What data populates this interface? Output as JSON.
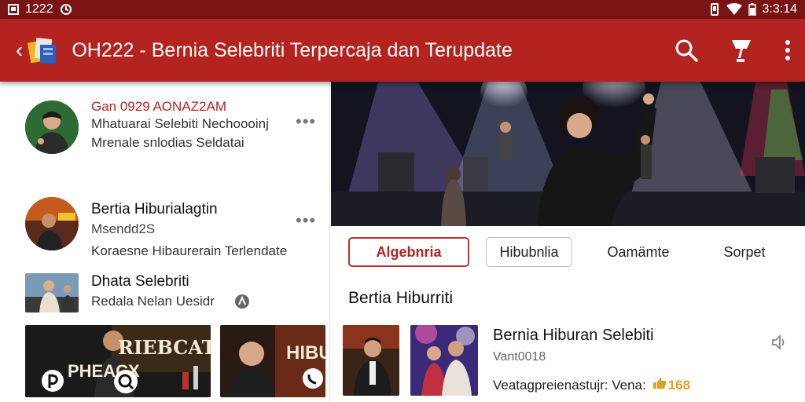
{
  "status_bar": {
    "time": "1222",
    "clock": "3:3:14",
    "left_icons": [
      "notification-icon",
      "sync-icon"
    ],
    "right_icons": [
      "vibrate-icon",
      "wifi-icon",
      "battery-icon"
    ]
  },
  "app_bar": {
    "title": "OH222 - Bernia Selebriti Terpercaja dan Terupdate",
    "actions": [
      "search-icon",
      "trophy-icon",
      "more-vert-icon"
    ],
    "background": "#b3231f"
  },
  "left_list": {
    "items": [
      {
        "title": "Gan 0929 AONAZ2AM",
        "subtitle": "Mhatuarai Selebiti Nechoooinj",
        "line3": "Mrenale snlodias Seldatai",
        "more": "•••"
      },
      {
        "title": "Bertia Hiburialagtin",
        "subtitle": "Msendd2S",
        "line3": "Koraesne Hibaurerain Terlendate",
        "more": "•••"
      },
      {
        "title": "Dhata Selebriti",
        "subtitle": "Redala Nelan Uesidr"
      }
    ],
    "thumbnails": [
      {
        "caption": "RIEBCATRITI",
        "caption2": "PHEACX"
      },
      {
        "caption": "HIBU"
      }
    ]
  },
  "right_panel": {
    "tabs": [
      {
        "label": "Algebnria",
        "active": true
      },
      {
        "label": "Hibubnlia",
        "active": false
      },
      {
        "label": "Oamämte",
        "active": false
      },
      {
        "label": "Sorpet",
        "active": false
      }
    ],
    "section_title": "Bertia  Hiburriti",
    "news": {
      "title": "Bernia Hiburan Selebiti",
      "subtitle": "Vant0018",
      "meta": "Veatagpreienastujr: Vena:",
      "badge": "168"
    }
  },
  "colors": {
    "accent": "#b3231f",
    "statusbar": "#7a1313",
    "active_tab": "#c0302b"
  }
}
